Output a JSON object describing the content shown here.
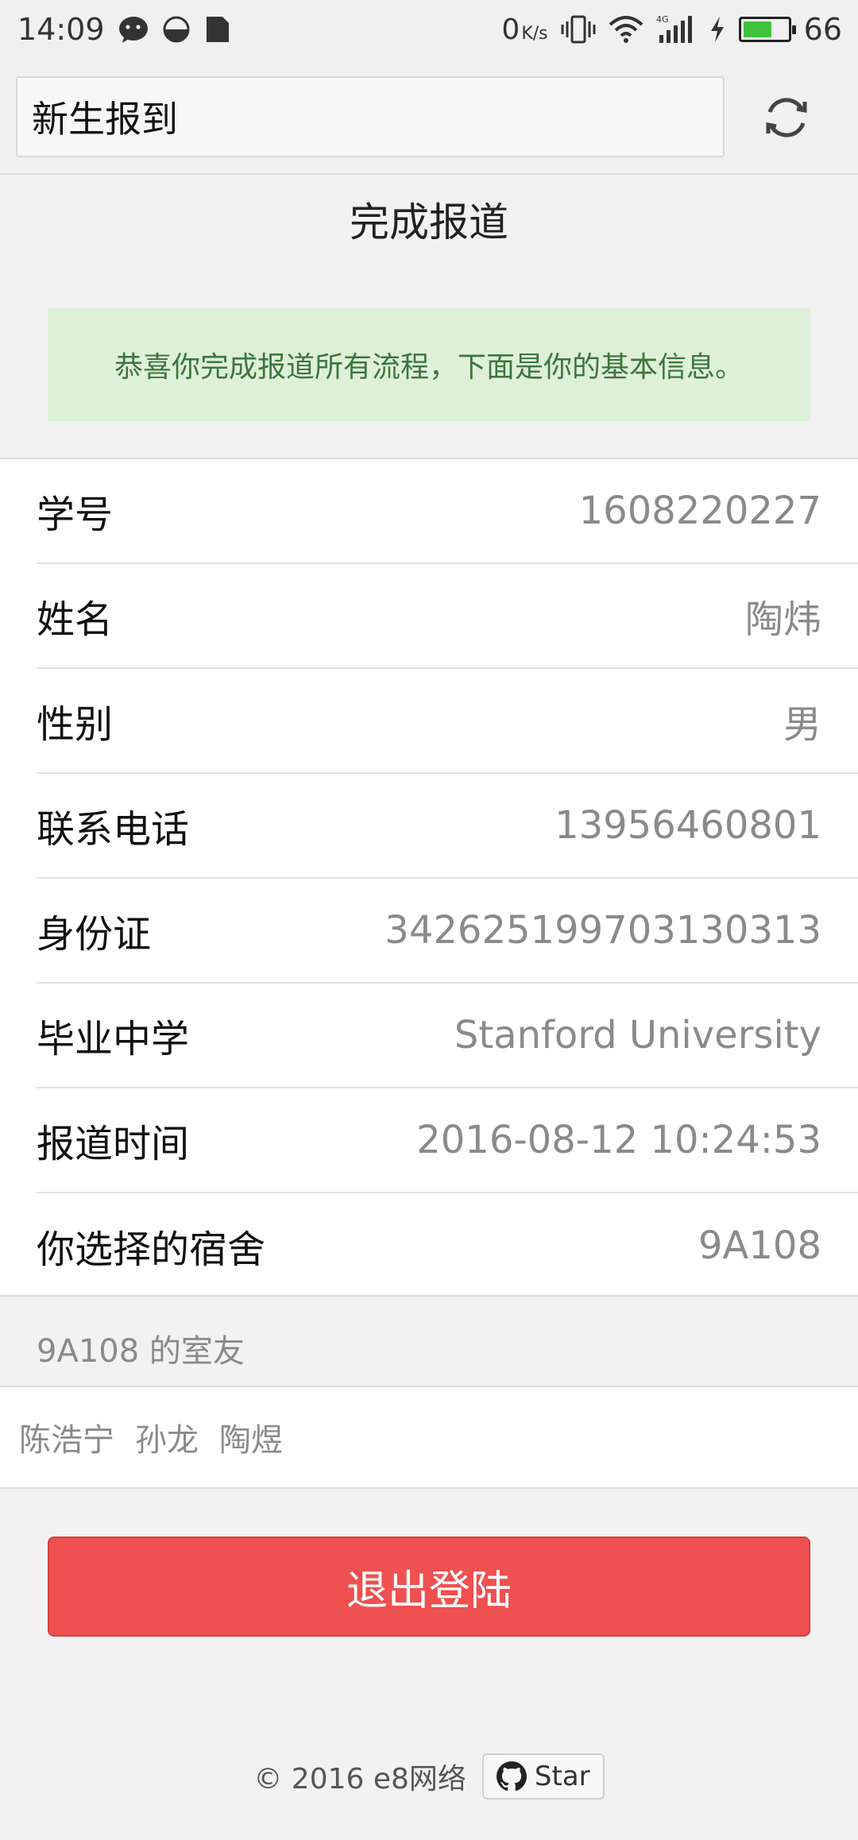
{
  "status_bar": {
    "time": "14:09",
    "net_speed": "0",
    "net_unit": "K/s",
    "signal_label": "4G",
    "battery": "66",
    "battery_level": 0.66,
    "icons": [
      "wechat-icon",
      "half-moon-icon",
      "sim-icon",
      "vibrate-icon",
      "wifi-icon",
      "signal-icon",
      "charging-icon",
      "battery-icon"
    ]
  },
  "appbar": {
    "title": "新生报到",
    "refresh_icon": "refresh-icon"
  },
  "page": {
    "title": "完成报道",
    "notice": "恭喜你完成报道所有流程，下面是你的基本信息。"
  },
  "info": [
    {
      "label": "学号",
      "value": "1608220227"
    },
    {
      "label": "姓名",
      "value": "陶炜"
    },
    {
      "label": "性别",
      "value": "男"
    },
    {
      "label": "联系电话",
      "value": "13956460801"
    },
    {
      "label": "身份证",
      "value": "342625199703130313"
    },
    {
      "label": "毕业中学",
      "value": "Stanford University"
    },
    {
      "label": "报道时间",
      "value": "2016-08-12 10:24:53"
    },
    {
      "label": "你选择的宿舍",
      "value": "9A108"
    }
  ],
  "roommates": {
    "header": "9A108 的室友",
    "names": [
      "陈浩宁",
      "孙龙",
      "陶煜"
    ]
  },
  "logout_label": "退出登陆",
  "footer": {
    "copyright": "© 2016 e8网络",
    "star_label": "Star"
  },
  "colors": {
    "notice_bg": "#dff0d8",
    "notice_text": "#3c763d",
    "logout_bg": "#ef5050",
    "battery_fill": "#3ec23e"
  }
}
